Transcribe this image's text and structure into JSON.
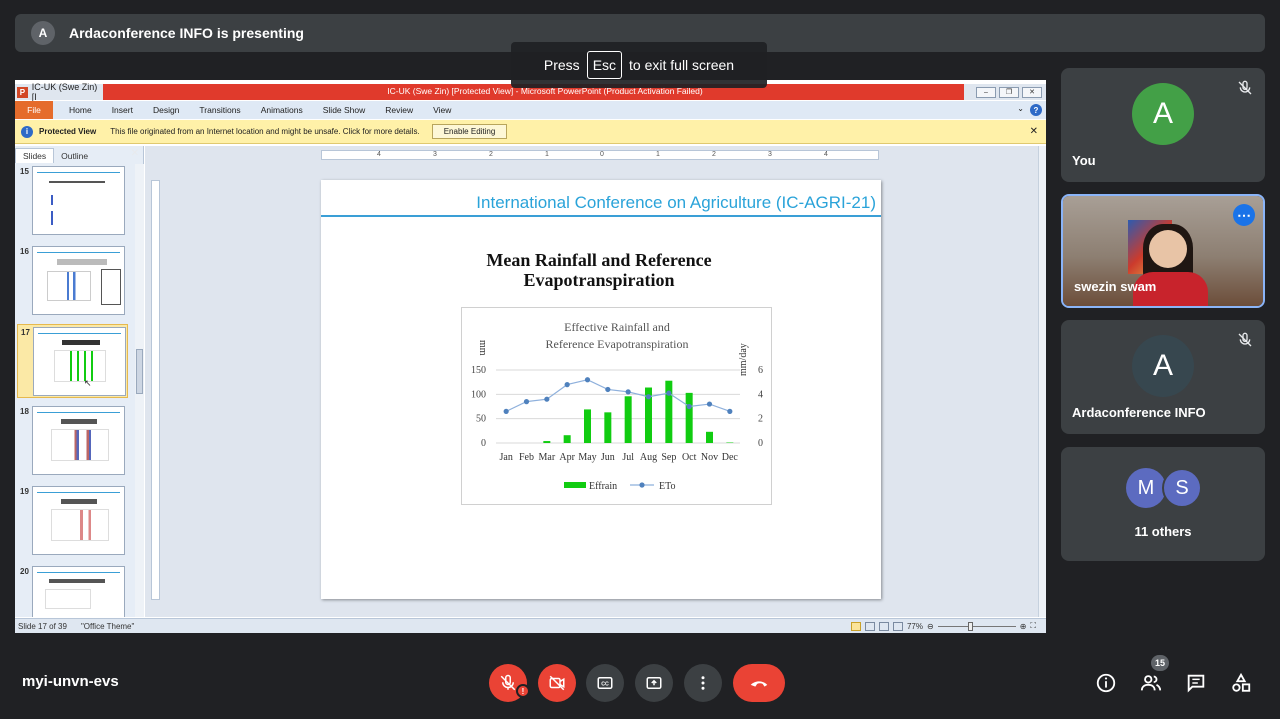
{
  "banner": {
    "avatar_letter": "A",
    "text": "Ardaconference INFO is presenting"
  },
  "fullscreen_hint": {
    "press": "Press",
    "key": "Esc",
    "rest": "to exit full screen"
  },
  "ppt": {
    "tab_title": "IC-UK (Swe Zin) [I",
    "window_title": "IC-UK (Swe Zin) [Protected View] - Microsoft PowerPoint (Product Activation Failed)",
    "menu": [
      "File",
      "Home",
      "Insert",
      "Design",
      "Transitions",
      "Animations",
      "Slide Show",
      "Review",
      "View"
    ],
    "protected": {
      "label": "Protected View",
      "message": "This file originated from an Internet location and might be unsafe. Click for more details.",
      "button": "Enable Editing"
    },
    "panel_tabs": {
      "slides": "Slides",
      "outline": "Outline"
    },
    "thumb_numbers": [
      "15",
      "16",
      "17",
      "18",
      "19",
      "20"
    ],
    "ruler_labels": [
      "4",
      "3",
      "2",
      "1",
      "0",
      "1",
      "2",
      "3",
      "4"
    ],
    "slide": {
      "header": "International Conference on Agriculture (IC-AGRI-21)",
      "title_line1": "Mean Rainfall and Reference",
      "title_line2": "Evapotranspiration"
    },
    "status": {
      "slide_of": "Slide 17 of 39",
      "theme": "\"Office Theme\"",
      "zoom": "77%"
    }
  },
  "chart_data": {
    "type": "bar",
    "title": "Effective Rainfall and Reference Evapotranspiration",
    "ylabel": "mm",
    "y2label": "mm/day",
    "ylim": [
      0,
      150
    ],
    "y2lim": [
      0,
      6
    ],
    "categories": [
      "Jan",
      "Feb",
      "Mar",
      "Apr",
      "May",
      "Jun",
      "Jul",
      "Aug",
      "Sep",
      "Oct",
      "Nov",
      "Dec"
    ],
    "yticks": [
      0,
      50,
      100,
      150
    ],
    "y2ticks": [
      0,
      2,
      4,
      6
    ],
    "series": [
      {
        "name": "Effrain",
        "kind": "bar",
        "axis": "left",
        "color": "#11cc11",
        "values": [
          0,
          0,
          4,
          16,
          69,
          63,
          96,
          114,
          128,
          103,
          23,
          1
        ]
      },
      {
        "name": "ETo",
        "kind": "line",
        "axis": "right",
        "color": "#4f81bd",
        "values": [
          2.6,
          3.4,
          3.6,
          4.8,
          5.2,
          4.4,
          4.2,
          3.8,
          4.1,
          3.0,
          3.2,
          2.6
        ]
      }
    ],
    "legend": "bottom"
  },
  "participants": [
    {
      "letter": "A",
      "name": "You",
      "color": "#43a047",
      "muted": true
    },
    {
      "name": "swezin swam"
    },
    {
      "letter": "A",
      "name": "Ardaconference INFO",
      "color": "#37474f",
      "muted": true
    },
    {
      "letters": [
        "M",
        "S"
      ],
      "name": "11 others",
      "colors": [
        "#5c6bc0",
        "#5c6bc0"
      ]
    }
  ],
  "meeting": {
    "code": "myi-unvn-evs",
    "people_count": "15"
  }
}
